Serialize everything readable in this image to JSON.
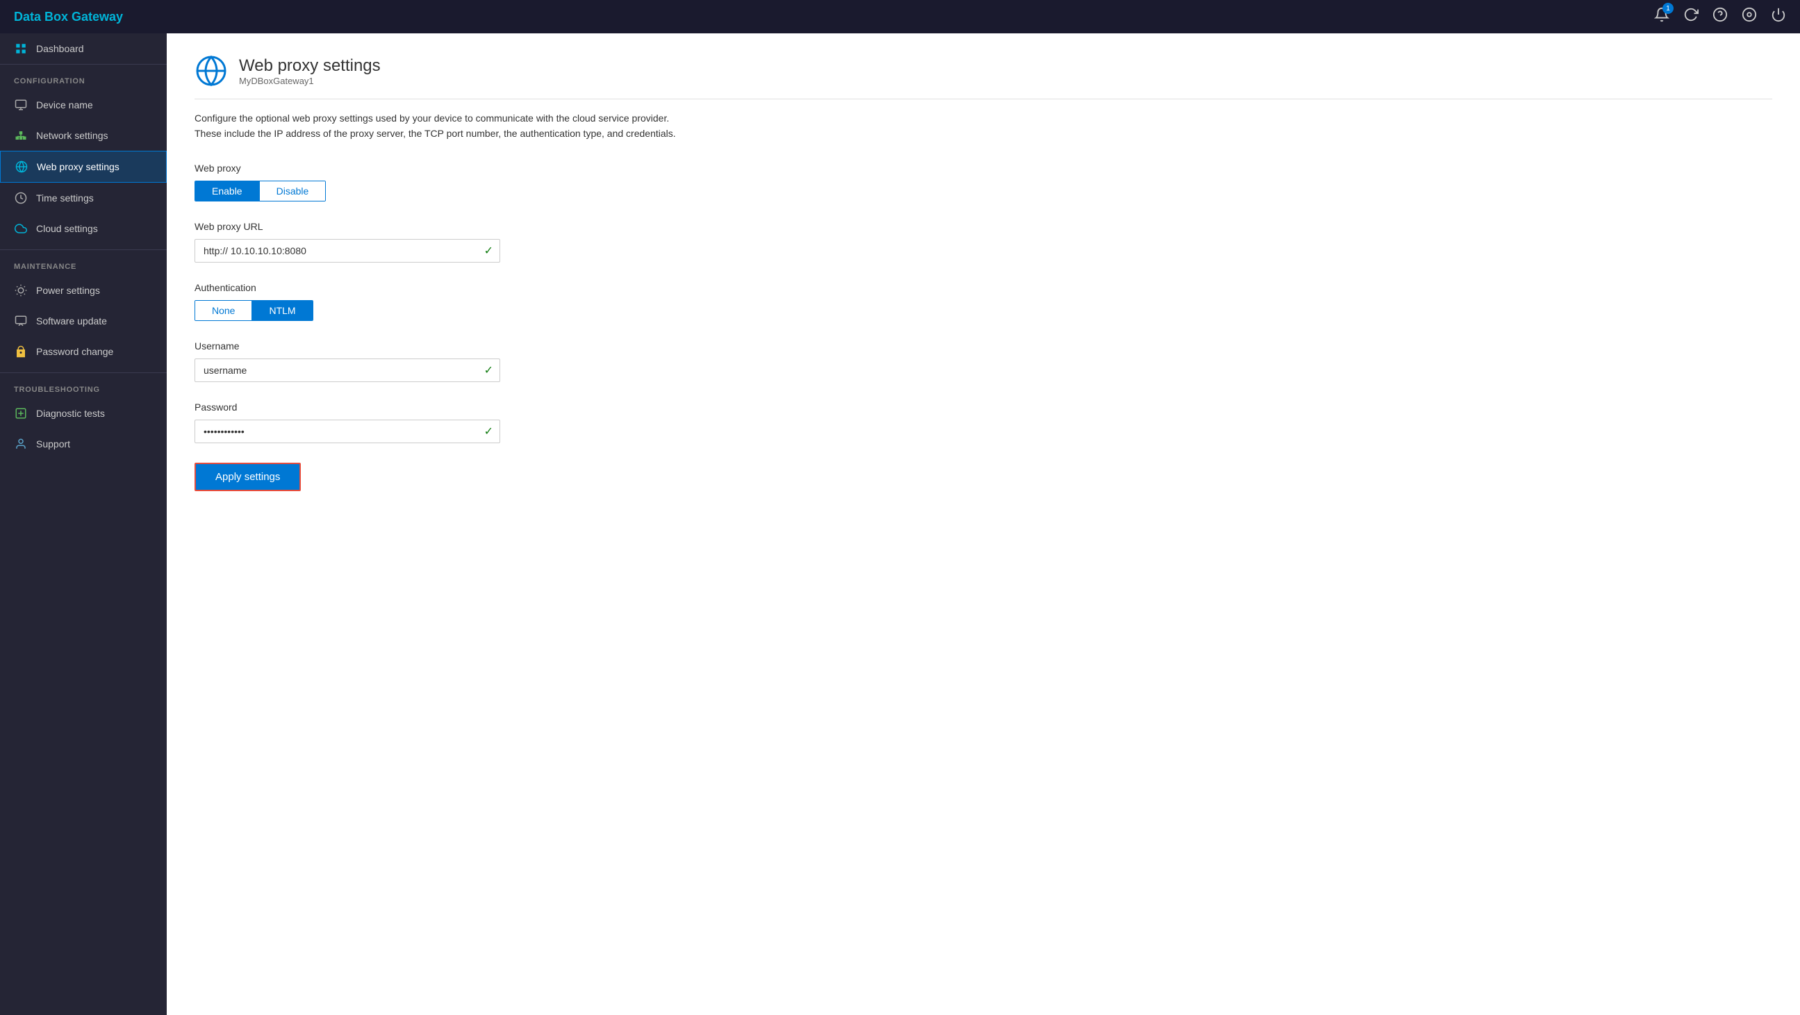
{
  "app": {
    "title": "Data Box Gateway"
  },
  "topbar": {
    "icons": {
      "notification_label": "notifications",
      "notification_count": "1",
      "refresh_label": "refresh",
      "help_label": "help",
      "settings_label": "settings",
      "power_label": "power"
    }
  },
  "sidebar": {
    "dashboard_label": "Dashboard",
    "config_section": "CONFIGURATION",
    "items_config": [
      {
        "id": "device-name",
        "label": "Device name",
        "icon": "device"
      },
      {
        "id": "network-settings",
        "label": "Network settings",
        "icon": "network"
      },
      {
        "id": "web-proxy-settings",
        "label": "Web proxy settings",
        "icon": "web",
        "active": true
      }
    ],
    "items_config2": [
      {
        "id": "time-settings",
        "label": "Time settings",
        "icon": "time"
      },
      {
        "id": "cloud-settings",
        "label": "Cloud settings",
        "icon": "cloud"
      }
    ],
    "maintenance_section": "MAINTENANCE",
    "items_maintenance": [
      {
        "id": "power-settings",
        "label": "Power settings",
        "icon": "power"
      },
      {
        "id": "software-update",
        "label": "Software update",
        "icon": "update"
      },
      {
        "id": "password-change",
        "label": "Password change",
        "icon": "password"
      }
    ],
    "troubleshooting_section": "TROUBLESHOOTING",
    "items_troubleshooting": [
      {
        "id": "diagnostic-tests",
        "label": "Diagnostic tests",
        "icon": "diag"
      },
      {
        "id": "support",
        "label": "Support",
        "icon": "support"
      }
    ]
  },
  "content": {
    "page_title": "Web proxy settings",
    "page_subtitle": "MyDBoxGateway1",
    "description_line1": "Configure the optional web proxy settings used by your device to communicate with the cloud service provider.",
    "description_line2": "These include the IP address of the proxy server, the TCP port  number, the authentication type, and credentials.",
    "web_proxy_label": "Web proxy",
    "toggle_enable": "Enable",
    "toggle_disable": "Disable",
    "web_proxy_url_label": "Web proxy URL",
    "web_proxy_url_value": "http:// 10.10.10.10:8080",
    "authentication_label": "Authentication",
    "auth_none": "None",
    "auth_ntlm": "NTLM",
    "username_label": "Username",
    "username_value": "username",
    "password_label": "Password",
    "password_value": "••••••••••••••",
    "apply_button": "Apply settings"
  }
}
